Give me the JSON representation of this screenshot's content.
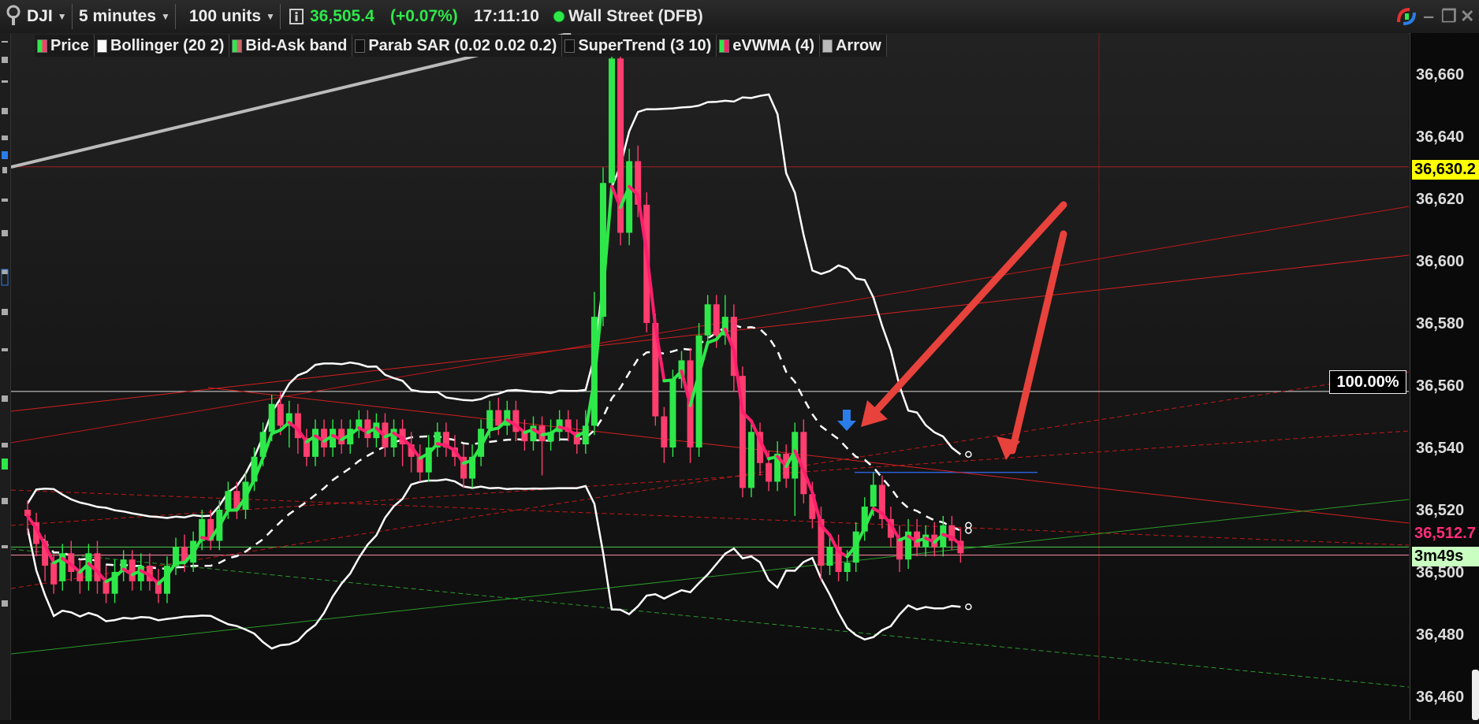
{
  "toolbar": {
    "symbol": "DJI",
    "timeframe": "5 minutes",
    "units": "100 units",
    "price": "36,505.4",
    "change": "(+0.07%)",
    "time": "17:11:10",
    "market": "Wall Street (DFB)"
  },
  "legend": [
    {
      "label": "Price",
      "color": "#2ecc40"
    },
    {
      "label": "Bollinger (20 2)",
      "color": "#ffffff"
    },
    {
      "label": "Bid-Ask band",
      "color": "#c96a6a"
    },
    {
      "label": "Parab SAR (0.02 0.02 0.2)",
      "color": "#111111"
    },
    {
      "label": "SuperTrend (3 10)",
      "color": "#111111"
    },
    {
      "label": "eVWMA (4)",
      "color": "#ff2d7a"
    },
    {
      "label": "Arrow",
      "color": "#bbbbbb"
    }
  ],
  "axis": {
    "labels": [
      "36,660",
      "36,640",
      "36,620",
      "36,600",
      "36,580",
      "36,560",
      "36,540",
      "36,520",
      "36,500",
      "36,480",
      "36,460"
    ],
    "tag_level": "36,630.2",
    "tag_bid": "36,512.7",
    "tag_countdown": "3m49s",
    "fib_label": "100.00%"
  },
  "colors": {
    "up": "#2ee84a",
    "down": "#ff3d6e",
    "bollinger": "#ffffff",
    "evwma_up": "#2ee84a",
    "evwma_down": "#ff1f6e",
    "trendline": "#d42020",
    "support": "#2a9a2a",
    "arrow": "#e8423c",
    "tag_yellow": "#ffff00"
  },
  "chart_data": {
    "type": "candlestick",
    "y_range": [
      36455,
      36670
    ],
    "tag_level_value": 36630.2,
    "fib_value": 36558,
    "signal": "sell arrow",
    "candles": [
      [
        36520,
        36518,
        36523,
        36512
      ],
      [
        36516,
        36509,
        36519,
        36505
      ],
      [
        36510,
        36502,
        36512,
        36497
      ],
      [
        36503,
        36496,
        36506,
        36493
      ],
      [
        36497,
        36506,
        36509,
        36494
      ],
      [
        36506,
        36500,
        36510,
        36497
      ],
      [
        36500,
        36497,
        36504,
        36493
      ],
      [
        36497,
        36506,
        36509,
        36494
      ],
      [
        36506,
        36497,
        36510,
        36493
      ],
      [
        36497,
        36493,
        36502,
        36490
      ],
      [
        36493,
        36500,
        36504,
        36490
      ],
      [
        36500,
        36504,
        36507,
        36497
      ],
      [
        36504,
        36497,
        36507,
        36494
      ],
      [
        36497,
        36502,
        36506,
        36494
      ],
      [
        36502,
        36497,
        36506,
        36494
      ],
      [
        36497,
        36493,
        36501,
        36490
      ],
      [
        36493,
        36502,
        36505,
        36490
      ],
      [
        36502,
        36508,
        36511,
        36499
      ],
      [
        36508,
        36503,
        36512,
        36500
      ],
      [
        36503,
        36510,
        36513,
        36500
      ],
      [
        36510,
        36517,
        36520,
        36507
      ],
      [
        36517,
        36510,
        36520,
        36507
      ],
      [
        36510,
        36520,
        36523,
        36507
      ],
      [
        36520,
        36526,
        36529,
        36517
      ],
      [
        36526,
        36520,
        36529,
        36517
      ],
      [
        36520,
        36529,
        36532,
        36517
      ],
      [
        36529,
        36537,
        36540,
        36526
      ],
      [
        36537,
        36545,
        36548,
        36534
      ],
      [
        36545,
        36554,
        36557,
        36542
      ],
      [
        36554,
        36547,
        36558,
        36544
      ],
      [
        36547,
        36551,
        36555,
        36540
      ],
      [
        36551,
        36543,
        36554,
        36538
      ],
      [
        36543,
        36537,
        36546,
        36534
      ],
      [
        36537,
        36546,
        36549,
        36534
      ],
      [
        36546,
        36540,
        36549,
        36537
      ],
      [
        36540,
        36546,
        36549,
        36537
      ],
      [
        36546,
        36541,
        36549,
        36538
      ],
      [
        36541,
        36546,
        36549,
        36538
      ],
      [
        36546,
        36549,
        36552,
        36543
      ],
      [
        36549,
        36543,
        36552,
        36540
      ],
      [
        36543,
        36548,
        36551,
        36540
      ],
      [
        36548,
        36540,
        36551,
        36537
      ],
      [
        36540,
        36546,
        36549,
        36537
      ],
      [
        36546,
        36541,
        36549,
        36534
      ],
      [
        36541,
        36537,
        36545,
        36532
      ],
      [
        36537,
        36532,
        36541,
        36529
      ],
      [
        36532,
        36540,
        36544,
        36529
      ],
      [
        36540,
        36545,
        36548,
        36537
      ],
      [
        36545,
        36540,
        36548,
        36537
      ],
      [
        36540,
        36537,
        36544,
        36534
      ],
      [
        36537,
        36530,
        36541,
        36527
      ],
      [
        36530,
        36537,
        36541,
        36527
      ],
      [
        36537,
        36546,
        36549,
        36534
      ],
      [
        36546,
        36552,
        36555,
        36543
      ],
      [
        36552,
        36547,
        36556,
        36544
      ],
      [
        36547,
        36552,
        36555,
        36544
      ],
      [
        36552,
        36545,
        36555,
        36542
      ],
      [
        36545,
        36542,
        36549,
        36539
      ],
      [
        36542,
        36547,
        36550,
        36539
      ],
      [
        36547,
        36542,
        36550,
        36531
      ],
      [
        36542,
        36545,
        36549,
        36539
      ],
      [
        36545,
        36549,
        36552,
        36542
      ],
      [
        36549,
        36545,
        36552,
        36542
      ],
      [
        36545,
        36541,
        36549,
        36538
      ],
      [
        36541,
        36547,
        36552,
        36538
      ],
      [
        36547,
        36582,
        36590,
        36544
      ],
      [
        36582,
        36625,
        36630,
        36579
      ],
      [
        36625,
        36665,
        36668,
        36620
      ],
      [
        36665,
        36609,
        36667,
        36605
      ],
      [
        36609,
        36632,
        36636,
        36605
      ],
      [
        36632,
        36618,
        36637,
        36614
      ],
      [
        36618,
        36580,
        36622,
        36577
      ],
      [
        36580,
        36550,
        36583,
        36547
      ],
      [
        36550,
        36540,
        36553,
        36535
      ],
      [
        36540,
        36562,
        36565,
        36537
      ],
      [
        36562,
        36568,
        36571,
        36559
      ],
      [
        36568,
        36540,
        36572,
        36535
      ],
      [
        36540,
        36576,
        36580,
        36537
      ],
      [
        36576,
        36586,
        36589,
        36573
      ],
      [
        36586,
        36576,
        36589,
        36572
      ],
      [
        36576,
        36582,
        36589,
        36573
      ],
      [
        36582,
        36563,
        36586,
        36558
      ],
      [
        36563,
        36527,
        36566,
        36524
      ],
      [
        36527,
        36545,
        36548,
        36524
      ],
      [
        36545,
        36535,
        36548,
        36531
      ],
      [
        36535,
        36529,
        36539,
        36526
      ],
      [
        36529,
        36538,
        36542,
        36526
      ],
      [
        36538,
        36530,
        36541,
        36527
      ],
      [
        36530,
        36545,
        36548,
        36518
      ],
      [
        36545,
        36525,
        36549,
        36522
      ],
      [
        36525,
        36517,
        36529,
        36514
      ],
      [
        36517,
        36502,
        36521,
        36497
      ],
      [
        36502,
        36508,
        36512,
        36499
      ],
      [
        36508,
        36500,
        36512,
        36497
      ],
      [
        36500,
        36503,
        36507,
        36497
      ],
      [
        36503,
        36513,
        36516,
        36500
      ],
      [
        36513,
        36521,
        36524,
        36510
      ],
      [
        36521,
        36528,
        36532,
        36518
      ],
      [
        36528,
        36517,
        36531,
        36514
      ],
      [
        36517,
        36511,
        36521,
        36508
      ],
      [
        36511,
        36504,
        36515,
        36500
      ],
      [
        36504,
        36513,
        36517,
        36501
      ],
      [
        36513,
        36508,
        36517,
        36505
      ],
      [
        36508,
        36512,
        36515,
        36505
      ],
      [
        36512,
        36508,
        36516,
        36505
      ],
      [
        36508,
        36515,
        36518,
        36505
      ],
      [
        36515,
        36510,
        36518,
        36507
      ],
      [
        36510,
        36506,
        36514,
        36503
      ]
    ]
  }
}
